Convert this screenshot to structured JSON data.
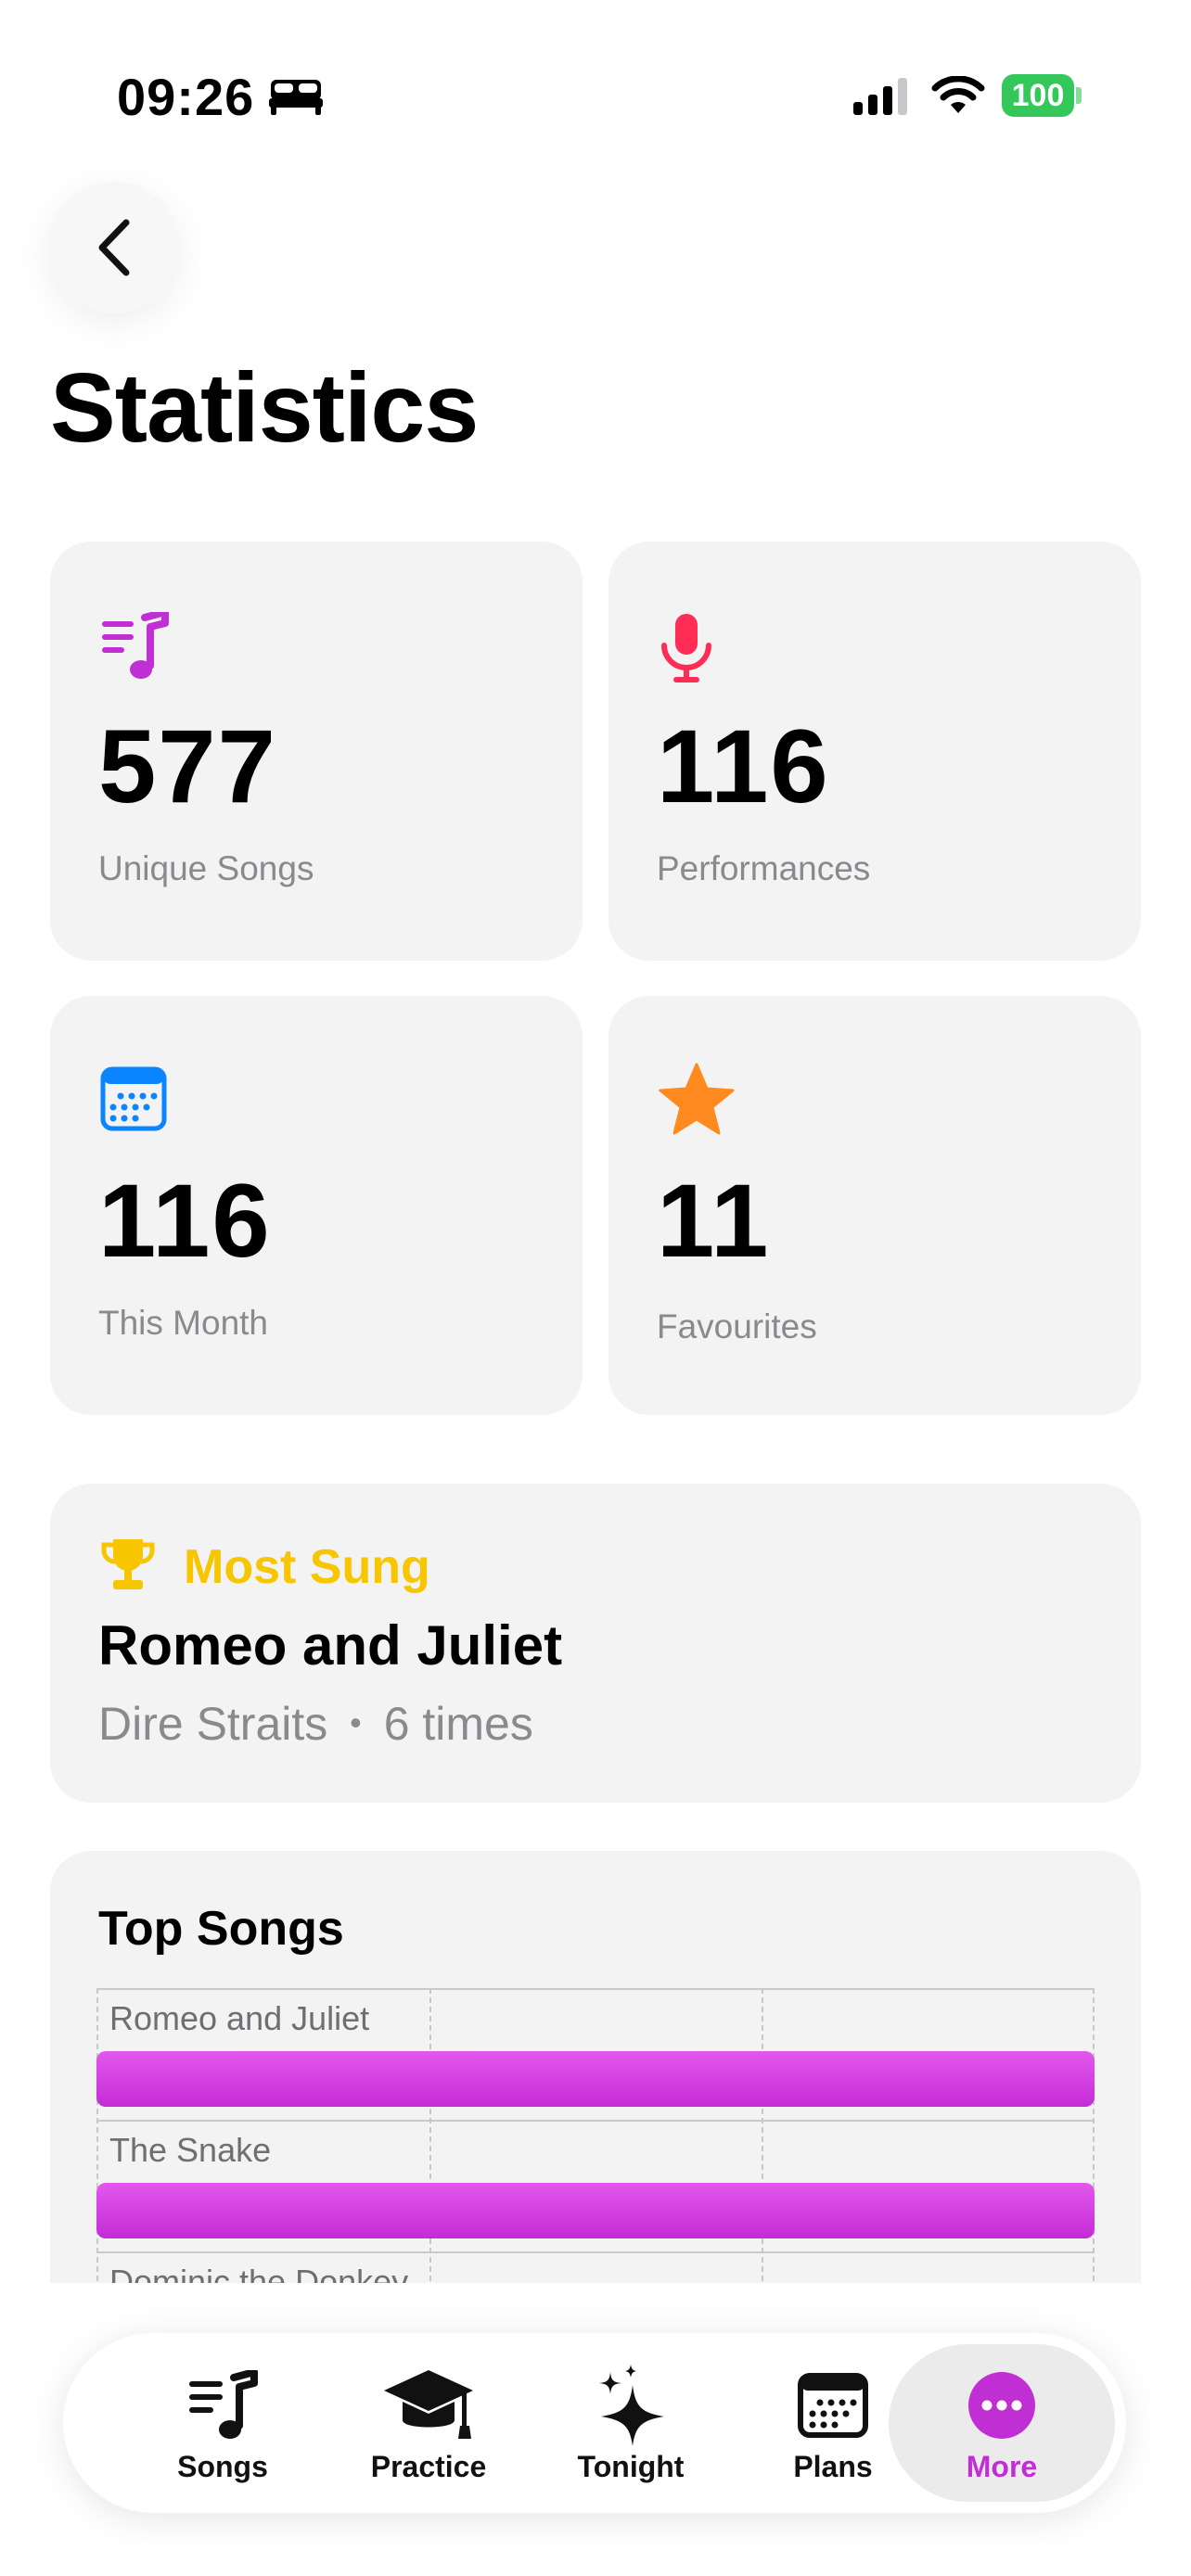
{
  "status_bar": {
    "time": "09:26",
    "battery": "100",
    "icons": [
      "bed-icon",
      "cellular-signal-icon",
      "wifi-icon",
      "battery-icon"
    ]
  },
  "nav": {
    "back_icon": "chevron-left-icon",
    "title": "Statistics"
  },
  "stats": [
    {
      "value": "577",
      "label": "Unique Songs",
      "icon": "music-list-icon",
      "color": "#c02fd4"
    },
    {
      "value": "116",
      "label": "Performances",
      "icon": "microphone-icon",
      "color": "#ff2d55"
    },
    {
      "value": "116",
      "label": "This Month",
      "icon": "calendar-icon",
      "color": "#0a84ff"
    },
    {
      "value": "11",
      "label": "Favourites",
      "icon": "star-icon",
      "color": "#ff8a1f"
    }
  ],
  "most_sung": {
    "icon": "trophy-icon",
    "label": "Most Sung",
    "title": "Romeo and Juliet",
    "artist": "Dire Straits",
    "separator": "•",
    "count": "6 times",
    "accent": "#f7c600"
  },
  "top_songs": {
    "title": "Top Songs",
    "chart_data": {
      "type": "bar",
      "orientation": "horizontal",
      "categories": [
        "Romeo and Juliet",
        "The Snake",
        "Dominic the Donkey"
      ],
      "values": [
        6,
        6,
        null
      ],
      "grid": true,
      "color": "#d23fe2"
    }
  },
  "tab_bar": {
    "tabs": [
      {
        "label": "Songs",
        "icon": "music-note-list-icon",
        "active": false
      },
      {
        "label": "Practice",
        "icon": "graduation-cap-icon",
        "active": false
      },
      {
        "label": "Tonight",
        "icon": "sparkles-icon",
        "active": false
      },
      {
        "label": "Plans",
        "icon": "calendar-icon",
        "active": false
      },
      {
        "label": "More",
        "icon": "ellipsis-circle-icon",
        "active": true
      }
    ],
    "active_color": "#c02fd4"
  }
}
